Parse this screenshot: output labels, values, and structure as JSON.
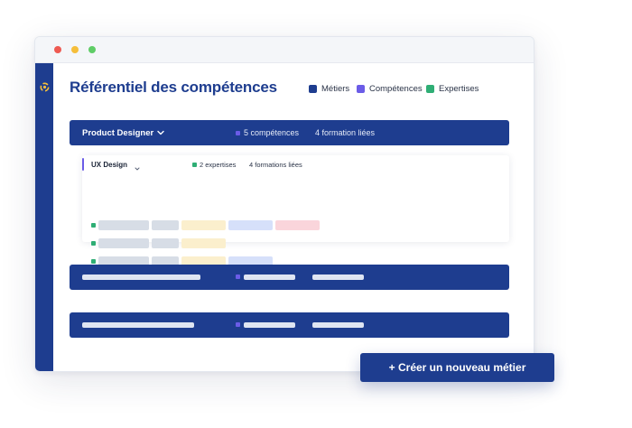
{
  "page": {
    "title": "Référentiel des compétences"
  },
  "legend": [
    {
      "label": "Métiers",
      "color": "#1e3d8f"
    },
    {
      "label": "Compétences",
      "color": "#6b5ce7"
    },
    {
      "label": "Expertises",
      "color": "#2fae75"
    }
  ],
  "metier": {
    "title": "Product Designer",
    "competences": "5 compétences",
    "formations": "4 formation liées"
  },
  "competence": {
    "title": "UX Design",
    "expertises": "2 expertises",
    "formations": "4 formations liées"
  },
  "cta": {
    "label": "+ Créer un nouveau métier"
  },
  "colors": {
    "primary": "#1e3d8f",
    "competence": "#6b5ce7",
    "expertise": "#2fae75"
  }
}
